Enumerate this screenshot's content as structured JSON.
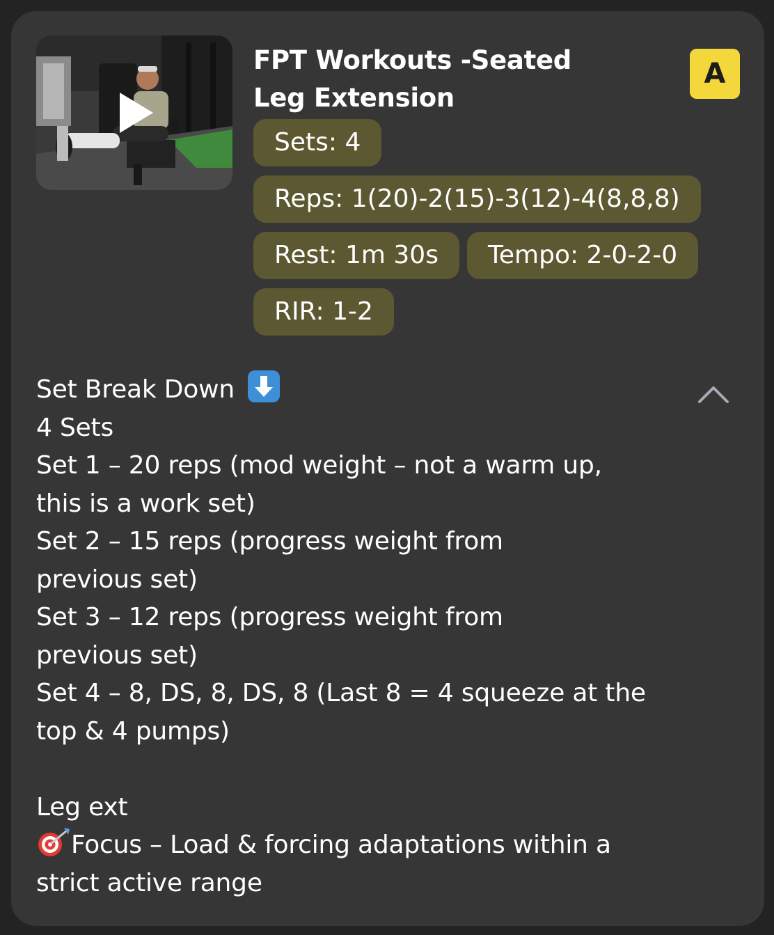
{
  "exercise": {
    "title_line1": "FPT Workouts -Seated",
    "title_line2": "Leg Extension",
    "badge": "A",
    "video_thumbnail": "play-icon"
  },
  "params": {
    "sets": "Sets: 4",
    "reps": "Reps: 1(20)-2(15)-3(12)-4(8,8,8)",
    "rest": "Rest: 1m 30s",
    "tempo": "Tempo: 2-0-2-0",
    "rir": "RIR: 1-2"
  },
  "description": {
    "heading": "Set Break Down",
    "heading_icon": "arrow-down-emoji-icon",
    "lines": [
      "4 Sets",
      "Set 1 – 20 reps (mod weight – not a warm up,",
      "this is a work set)",
      "Set 2 – 15 reps (progress weight from",
      "previous set)",
      "Set 3 – 12 reps (progress weight from",
      "previous set)",
      "Set 4 – 8, DS, 8, DS, 8 (Last 8 = 4 squeeze at the",
      "top & 4 pumps)"
    ],
    "section2_title": "Leg ext",
    "focus_icon": "target-dart-emoji-icon",
    "focus_line1": "Focus – Load & forcing adaptations within a",
    "focus_line2": "strict active range"
  },
  "collapse_icon": "chevron-up-icon",
  "colors": {
    "background": "#232323",
    "card": "#363636",
    "chip": "#5c5831",
    "badge": "#f4d83b",
    "text": "#ffffff"
  }
}
